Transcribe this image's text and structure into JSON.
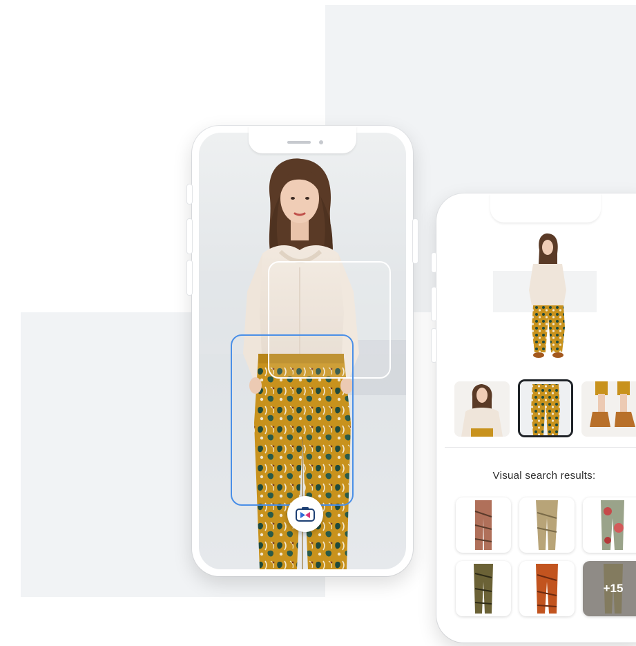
{
  "results_panel": {
    "heading": "Visual search results:",
    "more_count": "+15"
  },
  "colors": {
    "selection_box": "#4a8fe7",
    "focus_box": "#ffffff",
    "thumb_selected_border": "#1f2328",
    "background_square": "#f1f3f5"
  },
  "icons": {
    "camera_button": "camera-icon"
  }
}
